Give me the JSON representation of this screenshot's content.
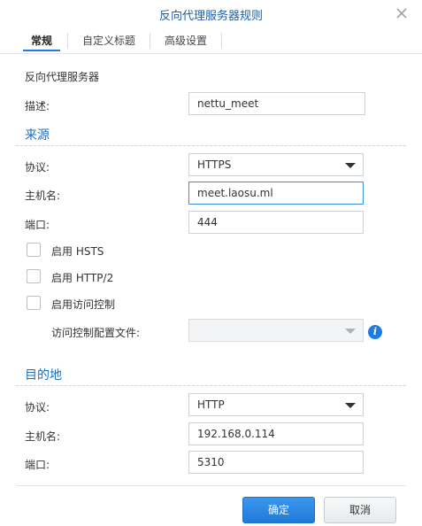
{
  "dialog": {
    "title": "反向代理服务器规则"
  },
  "tabs": [
    {
      "label": "常规",
      "active": true
    },
    {
      "label": "自定义标题",
      "active": false
    },
    {
      "label": "高级设置",
      "active": false
    }
  ],
  "general": {
    "heading": "反向代理服务器",
    "description_label": "描述:",
    "description_value": "nettu_meet"
  },
  "source": {
    "heading": "来源",
    "protocol_label": "协议:",
    "protocol_value": "HTTPS",
    "hostname_label": "主机名:",
    "hostname_value": "meet.laosu.ml",
    "port_label": "端口:",
    "port_value": "444",
    "hsts_label": "启用 HSTS",
    "hsts_checked": false,
    "http2_label": "启用 HTTP/2",
    "http2_checked": false,
    "access_control_label": "启用访问控制",
    "access_control_checked": false,
    "access_profile_label": "访问控制配置文件:",
    "access_profile_value": ""
  },
  "destination": {
    "heading": "目的地",
    "protocol_label": "协议:",
    "protocol_value": "HTTP",
    "hostname_label": "主机名:",
    "hostname_value": "192.168.0.114",
    "port_label": "端口:",
    "port_value": "5310"
  },
  "footer": {
    "ok_label": "确定",
    "cancel_label": "取消"
  },
  "icons": {
    "close": "close-icon",
    "info": "info-icon",
    "dropdown": "chevron-down-icon"
  },
  "colors": {
    "accent": "#1f7be0",
    "section": "#1f6fbf",
    "title": "#1d5fa5"
  }
}
